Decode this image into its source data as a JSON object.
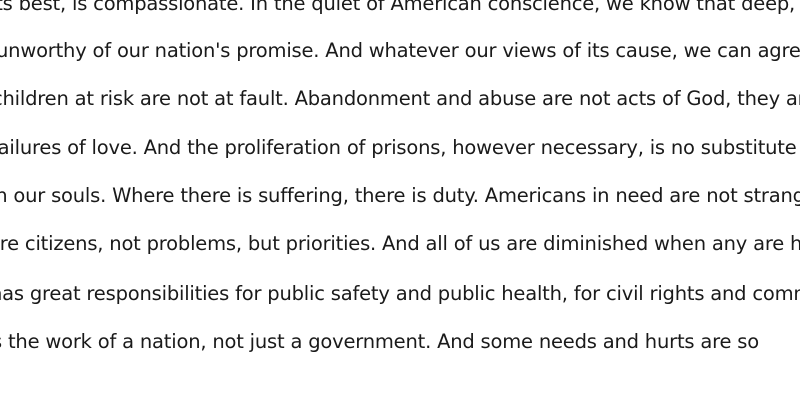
{
  "document": {
    "lines": [
      "its best, is compassionate. In the quiet of American conscience, we know that deep, persistent",
      "unworthy of our nation's promise. And whatever our views of its cause, we can agree that",
      "children at risk are not at fault. Abandonment and abuse are not acts of God, they are",
      "failures of love. And the proliferation of prisons, however necessary, is no substitute for hope",
      "in our souls. Where there is suffering, there is duty. Americans in need are not strangers, they",
      "are citizens, not problems, but priorities. And all of us are diminished when any are hopeless.",
      "has great responsibilities for public safety and public health, for civil rights and common",
      "s the work of a nation, not just a government. And some needs and hurts are so"
    ]
  }
}
